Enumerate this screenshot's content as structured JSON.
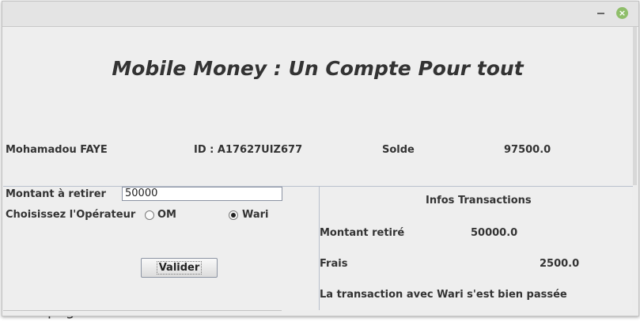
{
  "window": {
    "close_icon": "×"
  },
  "header": {
    "title": "Mobile Money : Un Compte Pour tout"
  },
  "account": {
    "name": "Mohamadou FAYE",
    "id": "ID : A17627UIZ677",
    "solde_label": "Solde",
    "solde_value": "97500.0"
  },
  "form": {
    "amount_label": "Montant à retirer",
    "amount_value": "50000",
    "operator_label": "Choisissez l'Opérateur",
    "operators": [
      {
        "label": "OM",
        "selected": false
      },
      {
        "label": "Wari",
        "selected": true
      }
    ],
    "submit_label": "Valider"
  },
  "transactions": {
    "title": "Infos Transactions",
    "amount_label": "Montant retiré",
    "amount_value": "50000.0",
    "fees_label": "Frais",
    "fees_value": "2500.0",
    "message": "La transaction avec Wari s'est bien passée"
  },
  "background": {
    "text_fragment": "png",
    "edge_fragment": "l"
  }
}
